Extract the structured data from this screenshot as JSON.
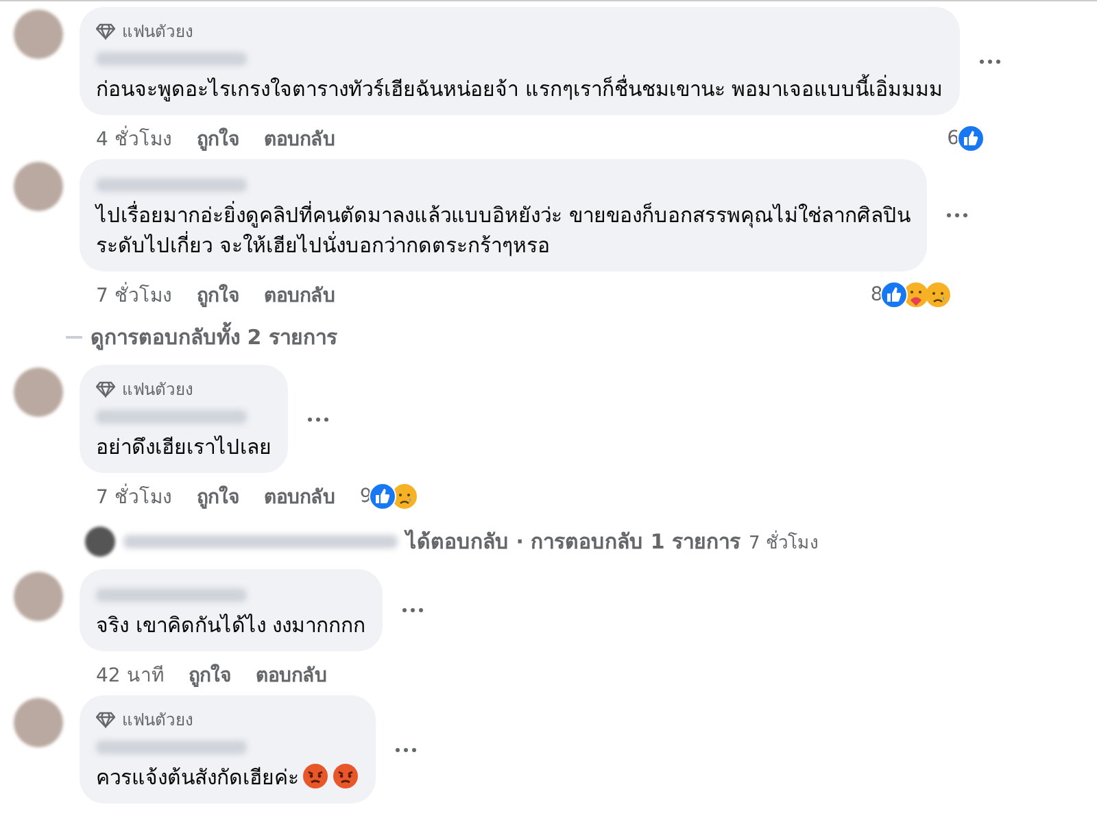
{
  "items": [
    {
      "kind": "comment",
      "badge": "แฟนตัวยง",
      "lines": [
        "ก่อนจะพูดอะไรเกรงใจตารางทัวร์เฮียฉันหน่อยจ้า แรกๆเราก็ชื่นชมเขานะ พอมาเจอแบบนี้เอิ่มมมม"
      ],
      "time": "4 ชั่วโมง",
      "actions": [
        "ถูกใจ",
        "ตอบกลับ"
      ],
      "reaction_count": "6",
      "reactions": [
        {
          "kind": "like"
        }
      ]
    },
    {
      "kind": "comment",
      "lines": [
        "ไปเรื่อยมากอ่ะยิ่งดูคลิปที่คนตัดมาลงแล้วแบบอิหยังว่ะ ขายของก็บอกสรรพคุณไม่ใช่ลากศิลปิน",
        "ระดับไปเกี่ยว จะให้เฮียไปนั่งบอกว่ากดตระกร้าๆหรอ"
      ],
      "time": "7 ชั่วโมง",
      "actions": [
        "ถูกใจ",
        "ตอบกลับ"
      ],
      "reaction_count": "8",
      "reactions": [
        {
          "kind": "like"
        },
        {
          "kind": "care"
        },
        {
          "kind": "sad"
        }
      ]
    },
    {
      "kind": "more_replies",
      "text": "ดูการตอบกลับทั้ง 2 รายการ"
    },
    {
      "kind": "comment",
      "badge": "แฟนตัวยง",
      "lines": [
        "อย่าดึงเฮียเราไปเลย"
      ],
      "time": "7 ชั่วโมง",
      "actions": [
        "ถูกใจ",
        "ตอบกลับ"
      ],
      "reaction_count": "9",
      "reactions": [
        {
          "kind": "like"
        },
        {
          "kind": "sad"
        }
      ]
    },
    {
      "kind": "reply_summary",
      "text": "ได้ตอบกลับ · การตอบกลับ 1 รายการ",
      "time": "7 ชั่วโมง"
    },
    {
      "kind": "comment",
      "lines": [
        "จริง เขาคิดกันได้ไง งงมากกกก"
      ],
      "time": "42 นาที",
      "actions": [
        "ถูกใจ",
        "ตอบกลับ"
      ]
    },
    {
      "kind": "comment",
      "badge": "แฟนตัวยง",
      "lines": [
        "ควรแจ้งต้นสังกัดเฮียค่ะ"
      ],
      "trailing_emoji": [
        {
          "kind": "angry"
        },
        {
          "kind": "angry"
        }
      ]
    }
  ]
}
